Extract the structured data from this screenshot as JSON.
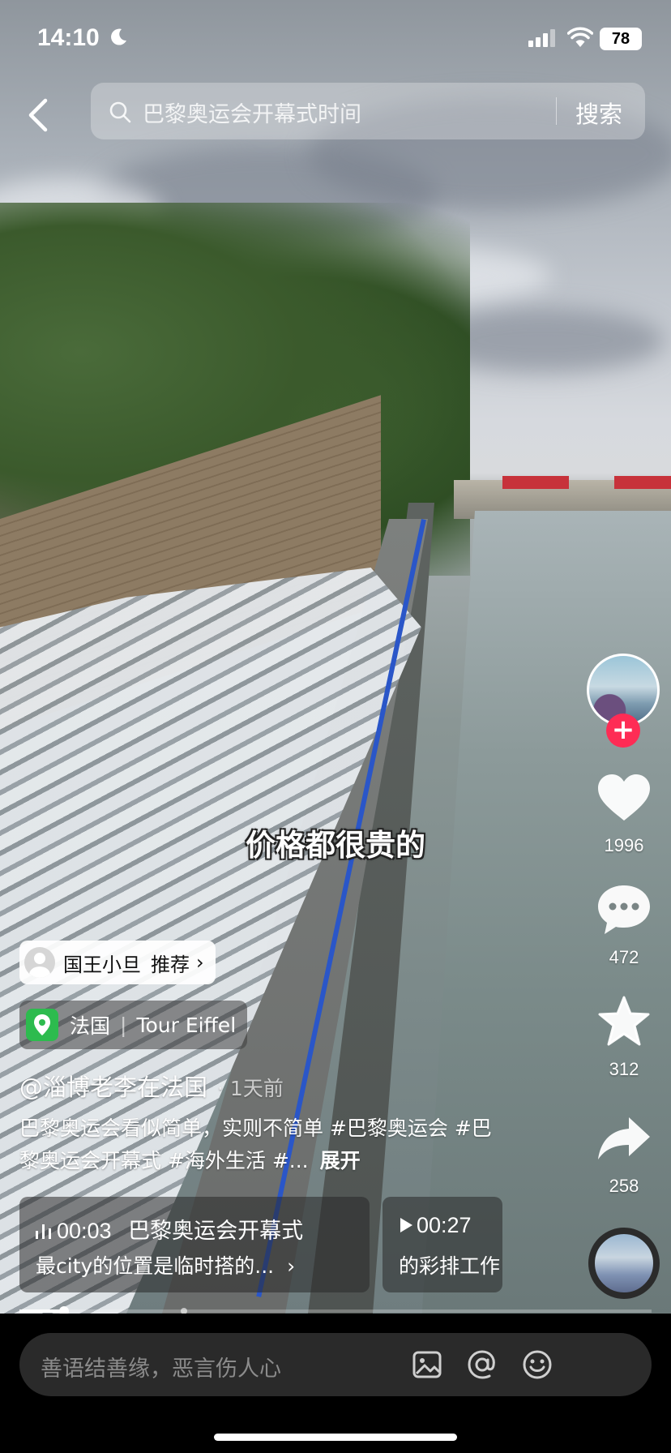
{
  "status_bar": {
    "time": "14:10",
    "battery": "78"
  },
  "search": {
    "query": "巴黎奥运会开幕式时间",
    "button_label": "搜索"
  },
  "overlay": {
    "subtitle": "价格都很贵的"
  },
  "actions": {
    "likes": "1996",
    "comments": "472",
    "favorites": "312",
    "shares": "258"
  },
  "recommend": {
    "name": "国王小旦",
    "label": "推荐",
    "arrow": "›"
  },
  "location": {
    "country": "法国",
    "place": "Tour Eiffel"
  },
  "post": {
    "author": "@淄博老李在法国",
    "time": "1天前",
    "description": "巴黎奥运会看似简单，实则不简单 #巴黎奥运会 #巴黎奥运会开幕式 #海外生活 #...",
    "expand_label": "展开"
  },
  "chapters": [
    {
      "time": "00:03",
      "title": "巴黎奥运会开幕式",
      "subtitle": "最city的位置是临时搭的...",
      "arrow": "›"
    },
    {
      "time": "00:27",
      "title": "",
      "subtitle": "的彩排工作"
    }
  ],
  "progress": {
    "played_fraction": 0.07,
    "chapter_marks": [
      0.26
    ]
  },
  "comment": {
    "placeholder": "善语结善缘，恶言伤人心"
  },
  "icons": {
    "back": "back-chevron-icon",
    "search": "search-icon",
    "like": "heart-icon",
    "comment": "comment-icon",
    "favorite": "star-icon",
    "share": "share-icon",
    "image": "image-icon",
    "mention": "at-icon",
    "emoji": "emoji-icon"
  },
  "colors": {
    "follow": "#fe2c55",
    "location_pin": "#2dbb4e"
  }
}
